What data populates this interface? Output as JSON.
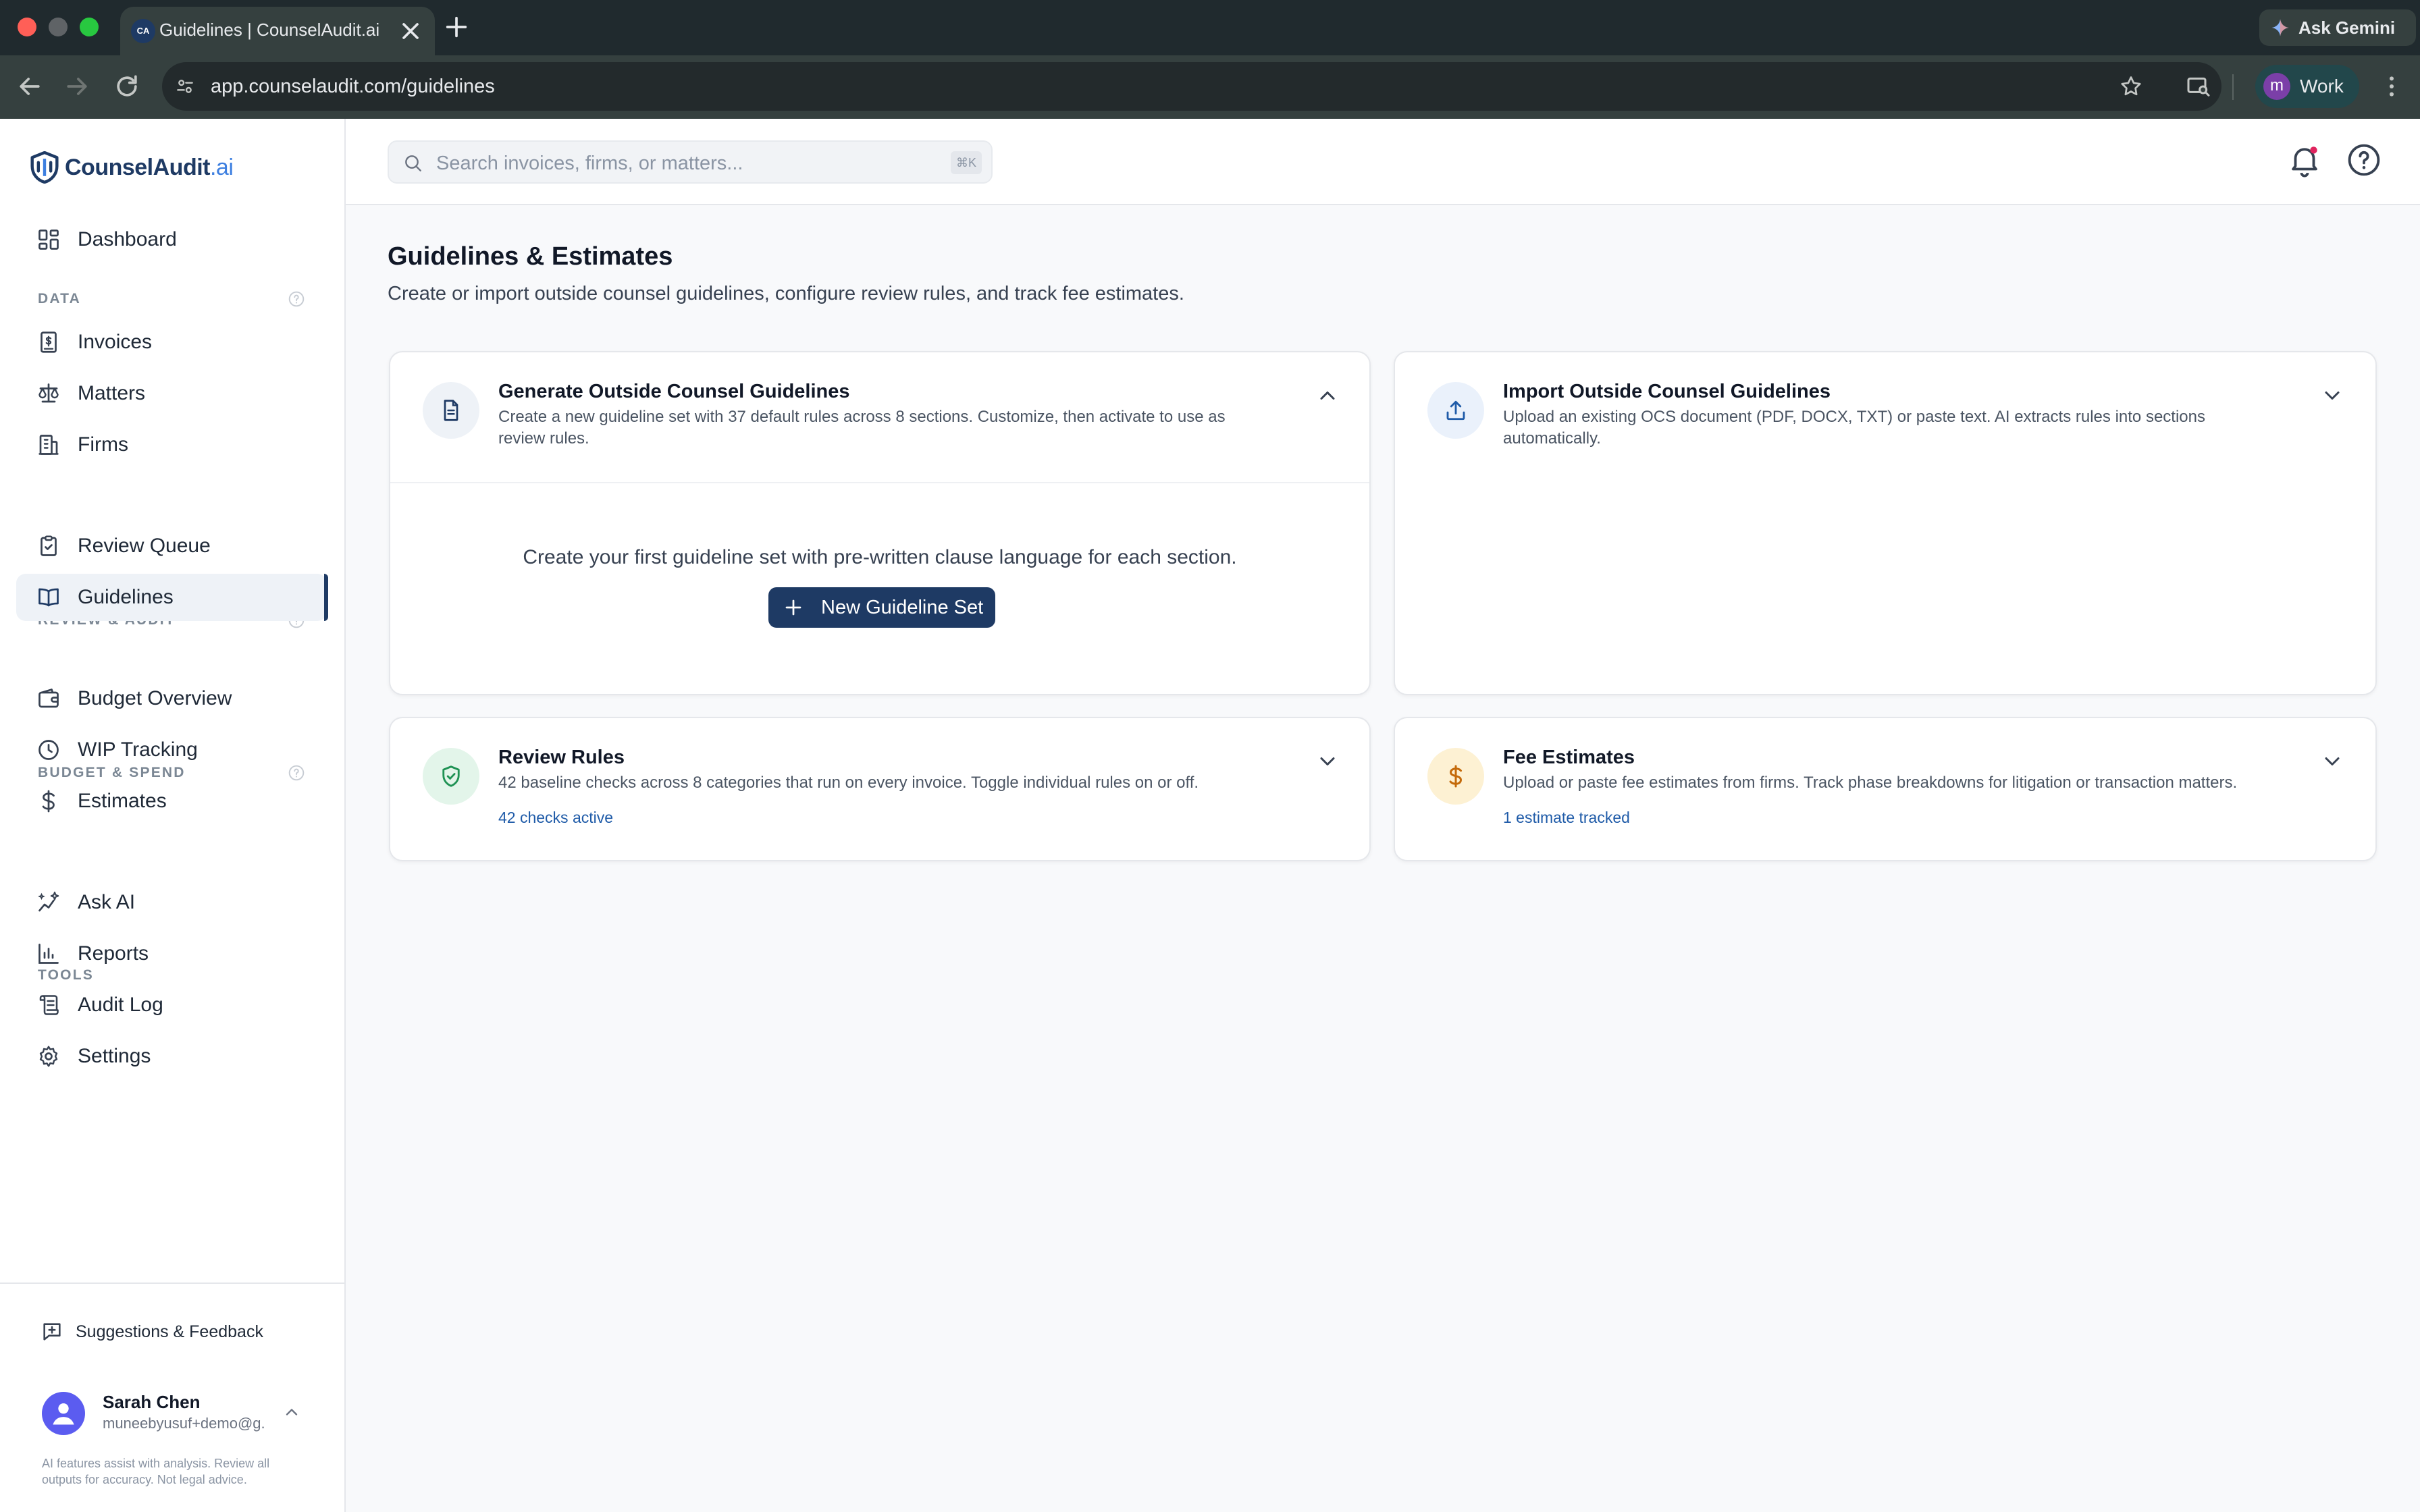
{
  "browser": {
    "tab_title": "Guidelines | CounselAudit.ai",
    "tab_favicon": "CA",
    "url": "app.counselaudit.com/guidelines",
    "ask_gemini": "Ask Gemini",
    "profile_initial": "m",
    "profile_label": "Work"
  },
  "brand": {
    "name": "CounselAudit",
    "suffix": ".ai"
  },
  "sidebar": {
    "dashboard": "Dashboard",
    "sections": {
      "data": "DATA",
      "review": "REVIEW & AUDIT",
      "budget": "BUDGET & SPEND",
      "tools": "TOOLS"
    },
    "items": {
      "invoices": "Invoices",
      "matters": "Matters",
      "firms": "Firms",
      "review_queue": "Review Queue",
      "guidelines": "Guidelines",
      "budget_overview": "Budget Overview",
      "wip_tracking": "WIP Tracking",
      "estimates": "Estimates",
      "ask_ai": "Ask AI",
      "reports": "Reports",
      "audit_log": "Audit Log",
      "settings": "Settings"
    },
    "active": "Guidelines",
    "feedback": "Suggestions & Feedback",
    "user": {
      "name": "Sarah Chen",
      "email": "muneebyusuf+demo@g..."
    },
    "disclaimer": "AI features assist with analysis. Review all outputs for accuracy. Not legal advice."
  },
  "topbar": {
    "search_placeholder": "Search invoices, firms, or matters...",
    "search_shortcut": "⌘K"
  },
  "page": {
    "title": "Guidelines & Estimates",
    "subtitle": "Create or import outside counsel guidelines, configure review rules, and track fee estimates."
  },
  "cards": {
    "generate": {
      "title": "Generate Outside Counsel Guidelines",
      "desc_line1": "Create a new guideline set with 37 default rules across 8 sections. Customize, then activate to use as",
      "desc_line2": "review rules.",
      "empty_text": "Create your first guideline set with pre-written clause language for each section.",
      "button": "New Guideline Set",
      "expanded": true
    },
    "import": {
      "title": "Import Outside Counsel Guidelines",
      "desc_line1": "Upload an existing OCS document (PDF, DOCX, TXT) or paste text. AI extracts rules into sections",
      "desc_line2": "automatically.",
      "expanded": false
    },
    "review_rules": {
      "title": "Review Rules",
      "desc": "42 baseline checks across 8 categories that run on every invoice. Toggle individual rules on or off.",
      "link": "42 checks active",
      "expanded": false
    },
    "fee_estimates": {
      "title": "Fee Estimates",
      "desc": "Upload or paste fee estimates from firms. Track phase breakdowns for litigation or transaction matters.",
      "link": "1 estimate tracked",
      "expanded": false
    }
  },
  "colors": {
    "brand_navy": "#1e3a64",
    "accent_blue": "#3d7fe0",
    "link_blue": "#1f5ba8",
    "green_tint": "#e3f5ea",
    "amber_tint": "#fdf1d3",
    "blue_tint": "#eaf1fb"
  },
  "icons": {
    "search": "search-icon",
    "bell": "bell-icon",
    "help": "help-circle-icon",
    "document": "document-icon",
    "upload": "upload-icon",
    "shield": "shield-check-icon",
    "dollar": "dollar-icon"
  }
}
